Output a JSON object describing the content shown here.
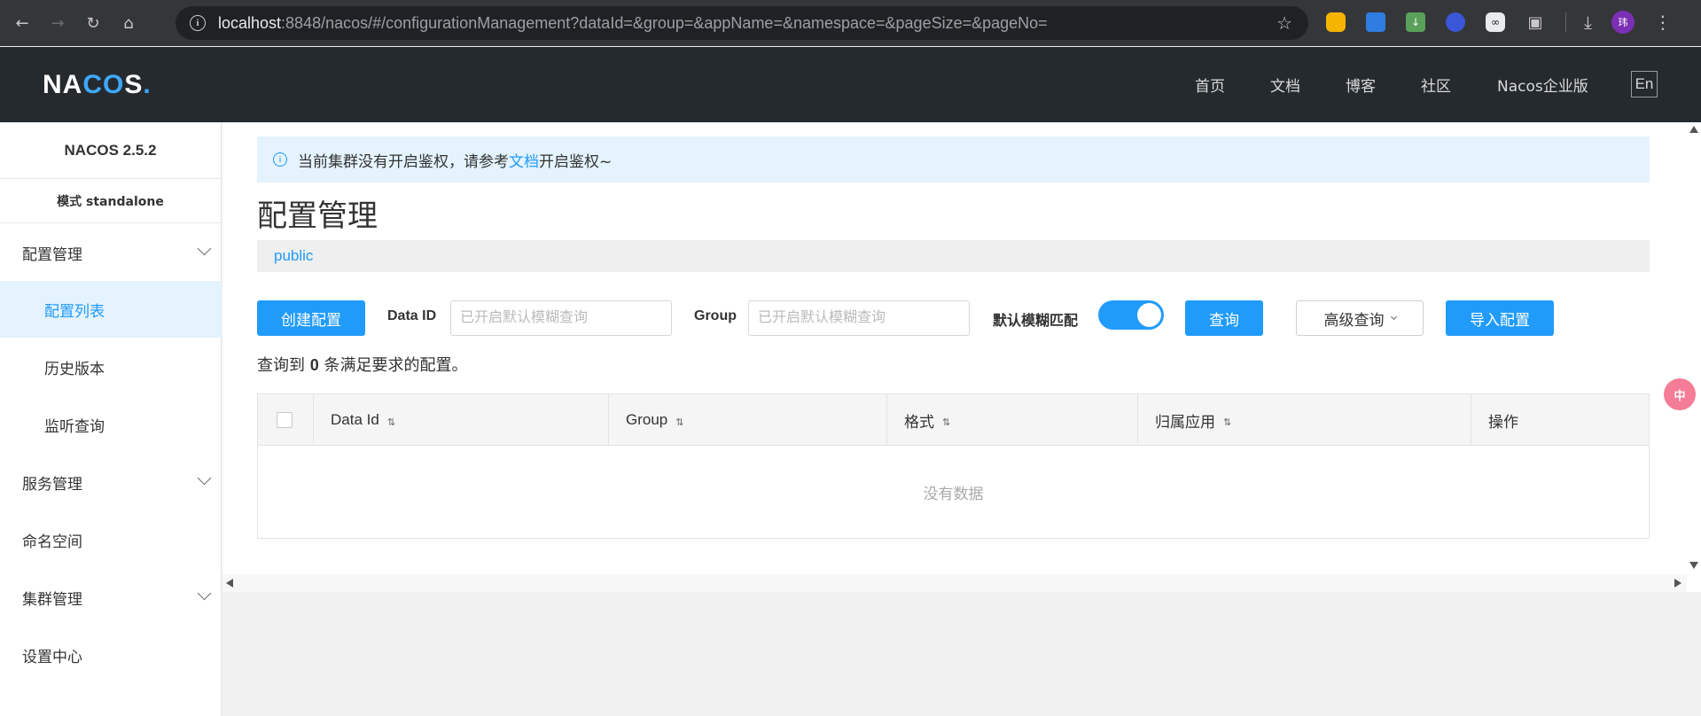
{
  "browser": {
    "url_host": "localhost",
    "url_rest": ":8848/nacos/#/configurationManagement?dataId=&group=&appName=&namespace=&pageSize=&pageNo=",
    "avatar_text": "玮"
  },
  "header": {
    "logo_pre": "NA",
    "logo_mid": "CO",
    "logo_post": "S",
    "logo_dot": ".",
    "nav": [
      "首页",
      "文档",
      "博客",
      "社区",
      "Nacos企业版"
    ],
    "lang": "En"
  },
  "sidebar": {
    "version": "NACOS 2.5.2",
    "mode": "模式 standalone",
    "items": [
      {
        "label": "配置管理"
      },
      {
        "label": "配置列表"
      },
      {
        "label": "历史版本"
      },
      {
        "label": "监听查询"
      },
      {
        "label": "服务管理"
      },
      {
        "label": "命名空间"
      },
      {
        "label": "集群管理"
      },
      {
        "label": "设置中心"
      }
    ],
    "active_item": "配置列表"
  },
  "notice": {
    "before": "当前集群没有开启鉴权，请参考",
    "link": "文档",
    "after": "开启鉴权~"
  },
  "page": {
    "title": "配置管理",
    "namespace": "public"
  },
  "toolbar": {
    "create_label": "创建配置",
    "data_id_label": "Data ID",
    "data_id_placeholder": "已开启默认模糊查询",
    "data_id_value": "",
    "group_label": "Group",
    "group_placeholder": "已开启默认模糊查询",
    "group_value": "",
    "fuzzy_label": "默认模糊匹配",
    "fuzzy_on": true,
    "query_label": "查询",
    "advanced_label": "高级查询",
    "import_label": "导入配置"
  },
  "result": {
    "prefix": "查询到",
    "count": "0",
    "suffix": "条满足要求的配置。"
  },
  "table": {
    "columns": [
      "Data Id",
      "Group",
      "格式",
      "归属应用",
      "操作"
    ],
    "empty_text": "没有数据"
  },
  "colors": {
    "primary": "#209bfa",
    "header_bg": "#252a2f",
    "active_bg": "#e4f3fe"
  }
}
